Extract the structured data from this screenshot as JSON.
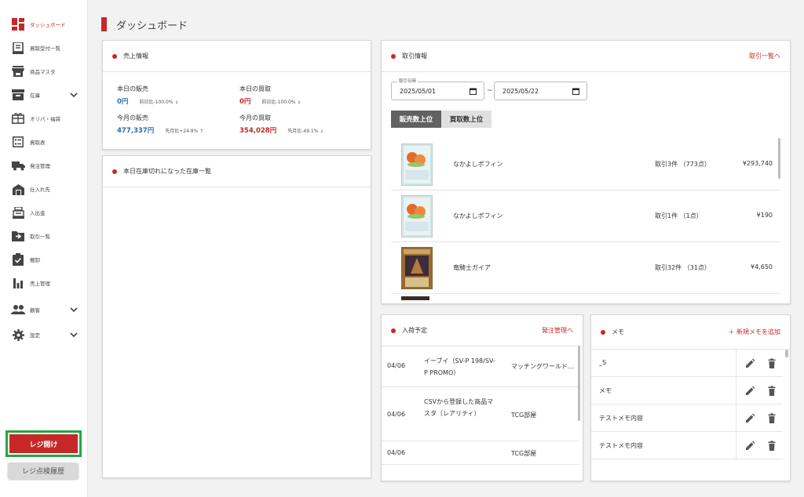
{
  "sidebar": {
    "items": [
      {
        "label": "ダッシュボード",
        "icon": "dashboard-icon",
        "active": true
      },
      {
        "label": "買取受付一覧",
        "icon": "receipt-icon"
      },
      {
        "label": "商品マスタ",
        "icon": "store-icon"
      },
      {
        "label": "在庫",
        "icon": "inventory-icon",
        "expandable": true
      },
      {
        "label": "オリパ・福袋",
        "icon": "gift-icon"
      },
      {
        "label": "買取表",
        "icon": "list-table-icon"
      },
      {
        "label": "発注管理",
        "icon": "truck-icon"
      },
      {
        "label": "仕入れ先",
        "icon": "factory-icon"
      },
      {
        "label": "入出金",
        "icon": "cash-register-icon"
      },
      {
        "label": "取引一覧",
        "icon": "folder-arrow-icon"
      },
      {
        "label": "棚卸",
        "icon": "checklist-icon"
      },
      {
        "label": "売上管理",
        "icon": "bar-chart-icon"
      },
      {
        "label": "顧客",
        "icon": "people-icon",
        "expandable": true
      },
      {
        "label": "設定",
        "icon": "gear-icon",
        "expandable": true
      }
    ],
    "open_register_label": "レジ開け",
    "history_label": "レジ点検履歴"
  },
  "header": {
    "title": "ダッシュボード"
  },
  "sales": {
    "title": "売上情報",
    "today_sales_label": "本日の販売",
    "today_sales_value": "0円",
    "today_sales_cmp": "前日比-100.0% ↓",
    "today_buy_label": "本日の買取",
    "today_buy_value": "0円",
    "today_buy_cmp": "前日比-100.0% ↓",
    "month_sales_label": "今月の販売",
    "month_sales_value": "477,337円",
    "month_sales_cmp": "先月比+24.8% ↑",
    "month_buy_label": "今月の買取",
    "month_buy_value": "354,028円",
    "month_buy_cmp": "先月比-49.1% ↓"
  },
  "stockout": {
    "title": "本日在庫切れになった在庫一覧"
  },
  "transactions": {
    "title": "取引情報",
    "link": "取引一覧へ",
    "date_label": "取引日時",
    "date_from": "2025/05/01",
    "date_to": "2025/05/22",
    "tilde": "~",
    "tab_sales": "販売数上位",
    "tab_buy": "買取数上位",
    "rows": [
      {
        "name": "なかよしポフィン",
        "count": "取引3件 （773点）",
        "amount": "¥293,740"
      },
      {
        "name": "なかよしポフィン",
        "count": "取引1件 （1点）",
        "amount": "¥190"
      },
      {
        "name": "竜騎士ガイア",
        "count": "取引32件 （31点）",
        "amount": "¥4,650"
      }
    ]
  },
  "arrivals": {
    "title": "入荷予定",
    "link": "発注管理へ",
    "rows": [
      {
        "date": "04/06",
        "name": "イーブイ（SV-P 198/SV-P PROMO）",
        "supplier": "マッチングワールド株式会社"
      },
      {
        "date": "04/06",
        "name": "CSVから登録した商品マスタ（レアリティ）",
        "supplier": "TCG部屋"
      },
      {
        "date": "04/06",
        "name": "",
        "supplier": "TCG部屋"
      }
    ]
  },
  "memo": {
    "title": "メモ",
    "add_label": "＋ 新規メモを追加",
    "items": [
      "_S",
      "メモ",
      "テストメモ内容",
      "テストメモ内容"
    ]
  },
  "colors": {
    "accent": "#c62828",
    "blue": "#2b6cb0",
    "highlight": "#26a541"
  }
}
